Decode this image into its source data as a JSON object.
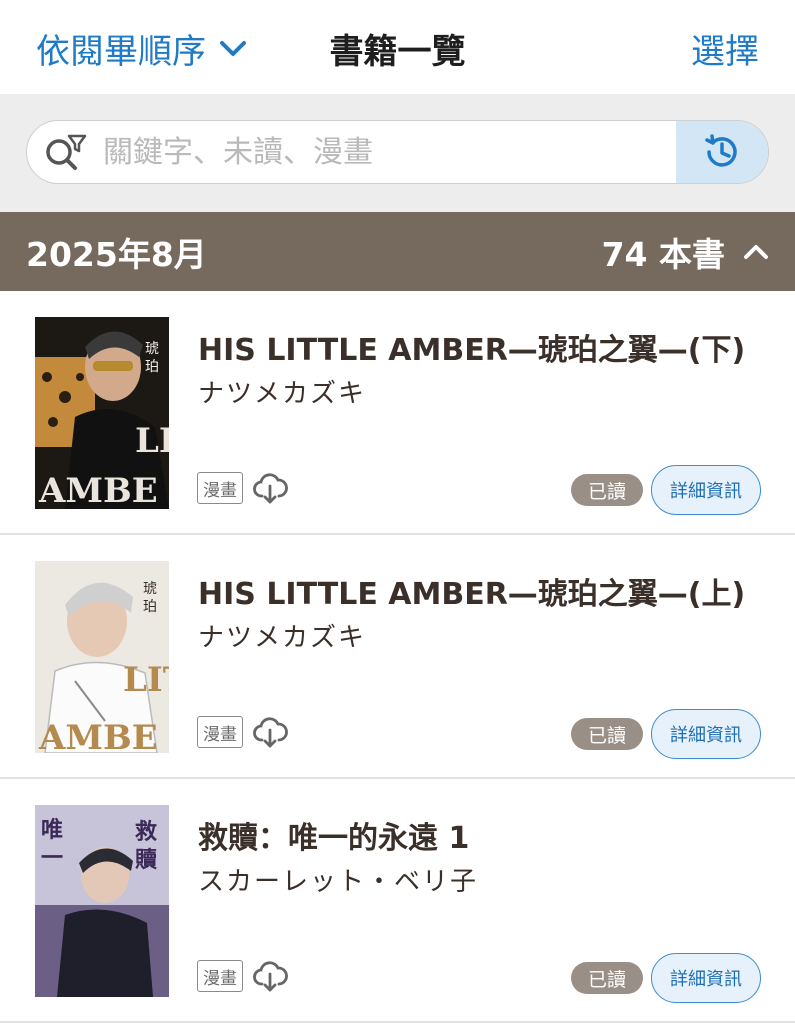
{
  "header": {
    "sort_label": "依閱畢順序",
    "title": "書籍一覽",
    "select_label": "選擇"
  },
  "search": {
    "placeholder": "關鍵字、未讀、漫畫"
  },
  "section": {
    "month": "2025年8月",
    "count": "74 本書"
  },
  "books": [
    {
      "title": "HIS LITTLE AMBER—琥珀之翼—(下)",
      "author": "ナツメカズキ",
      "type": "漫畫",
      "status": "已讀",
      "detail_label": "詳細資訊"
    },
    {
      "title": "HIS LITTLE AMBER—琥珀之翼—(上)",
      "author": "ナツメカズキ",
      "type": "漫畫",
      "status": "已讀",
      "detail_label": "詳細資訊"
    },
    {
      "title": "救贖：唯一的永遠 1",
      "author": "スカーレット・ベリ子",
      "type": "漫畫",
      "status": "已讀",
      "detail_label": "詳細資訊"
    }
  ],
  "colors": {
    "accent": "#1f7bc6",
    "month_bar": "#76695d",
    "read_badge": "#9a8f87"
  }
}
